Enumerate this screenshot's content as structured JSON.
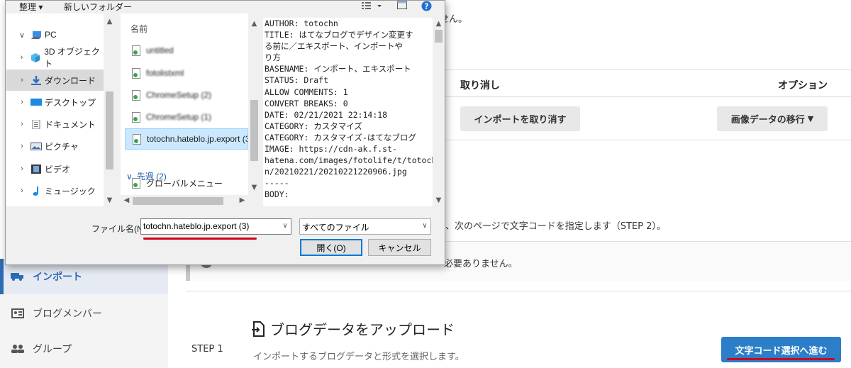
{
  "page": {
    "top_text": "せん。",
    "columns": {
      "cancel": "取り消し",
      "options": "オプション"
    },
    "buttons": {
      "cancel_import": "インポートを取り消す",
      "migrate_images": "画像データの移行"
    },
    "note_step2": "、次のページで文字コードを指定します（STEP 2）。",
    "info_note": "必要ありません。",
    "sidebar": [
      {
        "label": "インポート",
        "icon": "truck-icon"
      },
      {
        "label": "ブログメンバー",
        "icon": "member-card-icon"
      },
      {
        "label": "グループ",
        "icon": "group-icon"
      }
    ],
    "upload_title": "ブログデータをアップロード",
    "step_label": "STEP 1",
    "upload_desc": "インポートするブログデータと形式を選択します。",
    "next_button": "文字コード選択へ進む"
  },
  "dialog": {
    "toolbar": {
      "organize": "整理 ▾",
      "new_folder": "新しいフォルダー"
    },
    "nav": [
      {
        "label": "PC",
        "icon": "pc-icon",
        "chevron": "∨"
      },
      {
        "label": "3D オブジェクト",
        "icon": "cube-icon",
        "chevron": "›"
      },
      {
        "label": "ダウンロード",
        "icon": "download-icon",
        "chevron": "›"
      },
      {
        "label": "デスクトップ",
        "icon": "desktop-icon",
        "chevron": "›"
      },
      {
        "label": "ドキュメント",
        "icon": "document-icon",
        "chevron": "›"
      },
      {
        "label": "ピクチャ",
        "icon": "picture-icon",
        "chevron": "›"
      },
      {
        "label": "ビデオ",
        "icon": "video-icon",
        "chevron": "›"
      },
      {
        "label": "ミュージック",
        "icon": "music-icon",
        "chevron": "›"
      }
    ],
    "column_header": "名前",
    "files": [
      {
        "name": "untitled",
        "blurred": true
      },
      {
        "name": "fotolistxml",
        "blurred": true
      },
      {
        "name": "ChromeSetup (2)",
        "blurred": true
      },
      {
        "name": "ChromeSetup (1)",
        "blurred": true
      },
      {
        "name": "totochn.hateblo.jp.export (3",
        "blurred": false
      }
    ],
    "group_header": "先週 (2)",
    "group_files": [
      {
        "name": "グローバルメニュー"
      }
    ],
    "preview_text": "AUTHOR: totochn\nTITLE: はてなブログでデザイン変更す\nる前に／エキスポート、インポートや\nり方\nBASENAME: インポート、エキスポート\nSTATUS: Draft\nALLOW COMMENTS: 1\nCONVERT BREAKS: 0\nDATE: 02/21/2021 22:14:18\nCATEGORY: カスタマイズ\nCATEGORY: カスタマイズ-はてなブログ\nIMAGE: https://cdn-ak.f.st-\nhatena.com/images/fotolife/t/totoch\nn/20210221/20210221220906.jpg\n-----\nBODY:",
    "filename_label": "ファイル名(N):",
    "filename_value": "totochn.hateblo.jp.export (3)",
    "file_type": "すべてのファイル",
    "open_button": "開く(O)",
    "cancel_button": "キャンセル"
  },
  "colors": {
    "accent_blue": "#2c7ec9",
    "annotation_red": "#d0021b",
    "selection": "#cce8ff"
  }
}
